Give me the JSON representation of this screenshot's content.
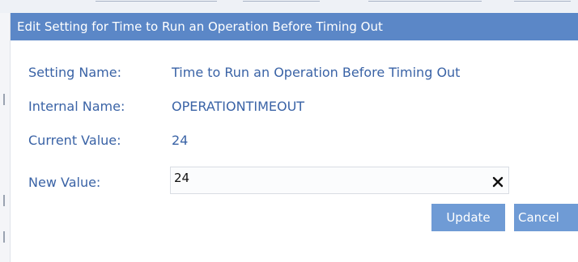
{
  "dialog": {
    "title": "Edit Setting for Time to Run an Operation Before Timing Out"
  },
  "fields": {
    "setting_name_label": "Setting Name:",
    "setting_name_value": "Time to Run an Operation Before Timing Out",
    "internal_name_label": "Internal Name:",
    "internal_name_value": "OPERATIONTIMEOUT",
    "current_value_label": "Current Value:",
    "current_value_value": "24",
    "new_value_label": "New Value:",
    "new_value_input": "24"
  },
  "buttons": {
    "update_label": "Update",
    "cancel_label": "Cancel"
  },
  "icons": {
    "clear": "close-icon"
  },
  "colors": {
    "titlebar": "#5b87c7",
    "label_text": "#3a63a6",
    "button": "#6f9bd5"
  }
}
